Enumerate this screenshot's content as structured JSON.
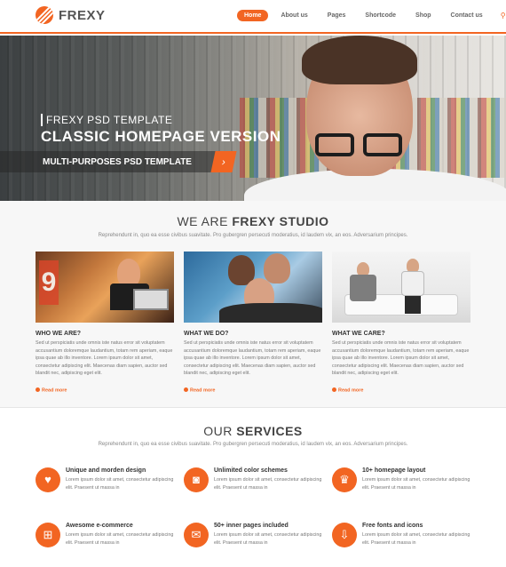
{
  "brand": {
    "name": "FREXY",
    "accent": "#f26522"
  },
  "nav": {
    "items": [
      "Home",
      "About us",
      "Pages",
      "Shortcode",
      "Shop",
      "Contact us"
    ],
    "active": "Home",
    "icons": [
      "search-icon",
      "cart-icon"
    ]
  },
  "hero": {
    "kicker": "FREXY PSD TEMPLATE",
    "title": "CLASSIC HOMEPAGE VERSION",
    "band": "MULTI-PURPOSES PSD TEMPLATE",
    "arrow": "›",
    "slides": 3,
    "active_slide": 1
  },
  "studio": {
    "title_plain": "WE ARE ",
    "title_bold": "FREXY STUDIO",
    "subtitle": "Reprehendunt in, quo ea esse civibus suavitate. Pro gubergren persecuti moderatius, id laudem vix, an eos. Adversarium principes.",
    "cards": [
      {
        "heading": "WHO WE ARE?",
        "text": "Sed ut perspiciatis unde omnis iste natus error sit voluptatem accusantium doloremque laudantium, totam rem aperiam, eaque ipsa quae ab illo inventore. Lorem ipsum dolor sit amet, consectetur adipiscing elit. Maecenas diam sapien, auctor sed blandit nec, adipiscing eget elit.",
        "more": "Read more"
      },
      {
        "heading": "WHAT WE DO?",
        "text": "Sed ut perspiciatis unde omnis iste natus error sit voluptatem accusantium doloremque laudantium, totam rem aperiam, eaque ipsa quae ab illo inventore. Lorem ipsum dolor sit amet, consectetur adipiscing elit. Maecenas diam sapien, auctor sed blandit nec, adipiscing eget elit.",
        "more": "Read more"
      },
      {
        "heading": "WHAT WE CARE?",
        "text": "Sed ut perspiciatis unde omnis iste natus error sit voluptatem accusantium doloremque laudantium, totam rem aperiam, eaque ipsa quae ab illo inventore. Lorem ipsum dolor sit amet, consectetur adipiscing elit. Maecenas diam sapien, auctor sed blandit nec, adipiscing eget elit.",
        "more": "Read more"
      }
    ]
  },
  "services": {
    "title_plain": "OUR ",
    "title_bold": "SERVICES",
    "subtitle": "Reprehendunt in, quo ea esse civibus suavitate. Pro gubergren persecuti moderatius, id laudem vix, an eos. Adversarium principes.",
    "items": [
      {
        "heading": "Unique and morden design",
        "text": "Lorem ipsum dolor sit amet, consectetur adipiscing elit. Praesent ut massa in",
        "icon": "heart-icon",
        "glyph": "♥"
      },
      {
        "heading": "Unlimited color schemes",
        "text": "Lorem ipsum dolor sit amet, consectetur adipiscing elit. Praesent ut massa in",
        "icon": "camera-icon",
        "glyph": "◙"
      },
      {
        "heading": "10+ homepage layout",
        "text": "Lorem ipsum dolor sit amet, consectetur adipiscing elit. Praesent ut massa in",
        "icon": "trophy-icon",
        "glyph": "♛"
      },
      {
        "heading": "Awesome e-commerce",
        "text": "Lorem ipsum dolor sit amet, consectetur adipiscing elit. Praesent ut massa in",
        "icon": "cart-icon",
        "glyph": "⊞"
      },
      {
        "heading": "50+ inner pages included",
        "text": "Lorem ipsum dolor sit amet, consectetur adipiscing elit. Praesent ut massa in",
        "icon": "chat-icon",
        "glyph": "✉"
      },
      {
        "heading": "Free fonts and icons",
        "text": "Lorem ipsum dolor sit amet, consectetur adipiscing elit. Praesent ut massa in",
        "icon": "download-icon",
        "glyph": "⇩"
      }
    ]
  }
}
